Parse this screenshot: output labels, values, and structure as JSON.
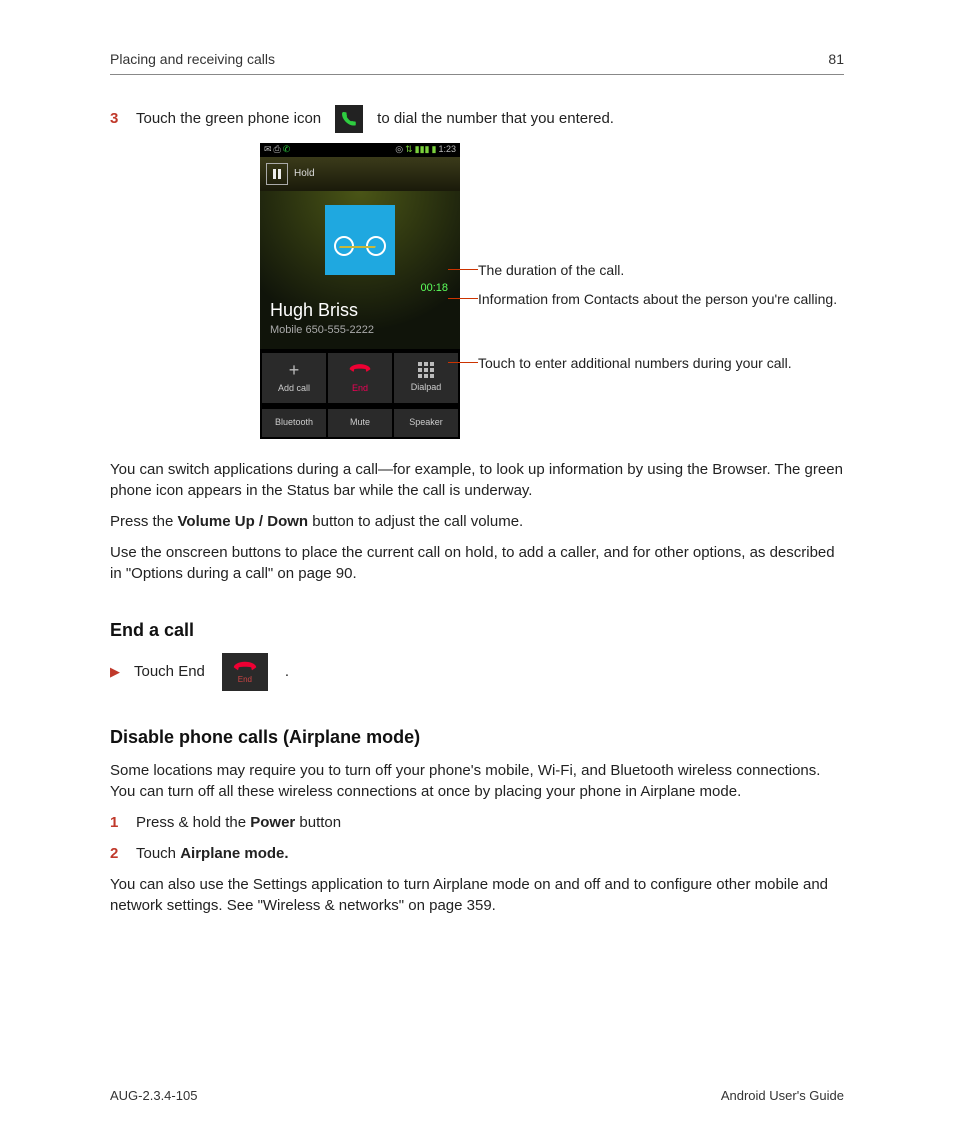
{
  "header": {
    "section": "Placing and receiving calls",
    "page": "81"
  },
  "step3": {
    "num": "3",
    "before": "Touch the green phone icon",
    "after": "to dial the number that you entered."
  },
  "phone": {
    "time": "1:23",
    "hold": "Hold",
    "duration": "00:18",
    "name": "Hugh Briss",
    "number": "Mobile 650-555-2222",
    "btns": {
      "add": "Add call",
      "end": "End",
      "dial": "Dialpad",
      "bt": "Bluetooth",
      "mute": "Mute",
      "spk": "Speaker"
    }
  },
  "callouts": {
    "c1": "The duration of the call.",
    "c2": "Information from Contacts about the person you're calling.",
    "c3": "Touch to enter additional numbers during your call."
  },
  "para": {
    "p1": "You can switch applications during a call—for example, to look up information by using the Browser. The green phone icon appears in the Status bar while the call is underway.",
    "p2a": "Press the ",
    "p2b": "Volume Up / Down",
    "p2c": " button to adjust the call volume.",
    "p3": "Use the onscreen buttons to place the current call on hold, to add a caller, and for other options, as described in \"Options during a call\" on page 90."
  },
  "end": {
    "heading": "End a call",
    "text": "Touch End",
    "chip": "End",
    "period": "."
  },
  "air": {
    "heading": "Disable phone calls (Airplane mode)",
    "p1": "Some locations may require you to turn off your phone's mobile, Wi-Fi, and Bluetooth wireless connections. You can turn off all these wireless connections at once by placing your phone in Airplane mode.",
    "s1": {
      "num": "1",
      "a": "Press & hold the ",
      "b": "Power",
      "c": " button"
    },
    "s2": {
      "num": "2",
      "a": "Touch ",
      "b": "Airplane mode."
    },
    "p2": "You can also use the Settings application to turn Airplane mode on and off and to configure other mobile and network settings. See \"Wireless & networks\" on page 359."
  },
  "footer": {
    "left": "AUG-2.3.4-105",
    "right": "Android User's Guide"
  }
}
